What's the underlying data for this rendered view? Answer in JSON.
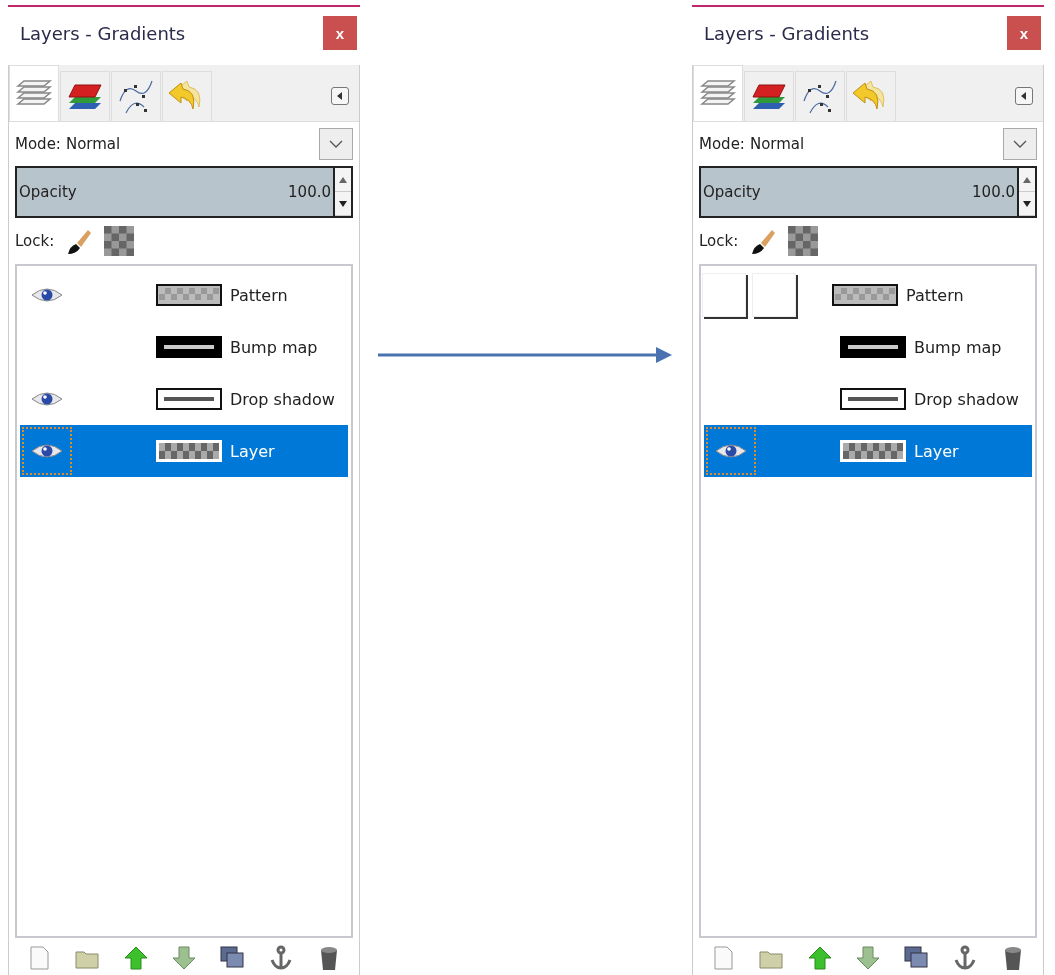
{
  "panels": [
    {
      "title": "Layers - Gradients",
      "close": "x",
      "tabs": [
        {
          "selected": true
        },
        {
          "selected": false
        },
        {
          "selected": false
        },
        {
          "selected": false
        }
      ],
      "mode_label": "Mode:",
      "mode_value": "Normal",
      "opacity": {
        "label": "Opacity",
        "reading": "100.0",
        "level": 1.0
      },
      "lock_label": "Lock:",
      "layers": [
        {
          "name": "Pattern",
          "visible": true,
          "hover_boxes": false,
          "selected": false
        },
        {
          "name": "Bump map",
          "visible": false,
          "hover_boxes": false,
          "selected": false
        },
        {
          "name": "Drop shadow",
          "visible": true,
          "hover_boxes": false,
          "selected": false
        },
        {
          "name": "Layer",
          "visible": true,
          "hover_boxes": false,
          "selected": true
        }
      ]
    },
    {
      "title": "Layers - Gradients",
      "close": "x",
      "tabs": [
        {
          "selected": true
        },
        {
          "selected": false
        },
        {
          "selected": false
        },
        {
          "selected": false
        }
      ],
      "mode_label": "Mode:",
      "mode_value": "Normal",
      "opacity": {
        "label": "Opacity",
        "reading": "100.0",
        "level": 1.0
      },
      "lock_label": "Lock:",
      "layers": [
        {
          "name": "Pattern",
          "visible": false,
          "hover_boxes": true,
          "selected": false
        },
        {
          "name": "Bump map",
          "visible": false,
          "hover_boxes": false,
          "selected": false
        },
        {
          "name": "Drop shadow",
          "visible": false,
          "hover_boxes": false,
          "selected": false
        },
        {
          "name": "Layer",
          "visible": true,
          "hover_boxes": false,
          "selected": true
        }
      ]
    }
  ]
}
